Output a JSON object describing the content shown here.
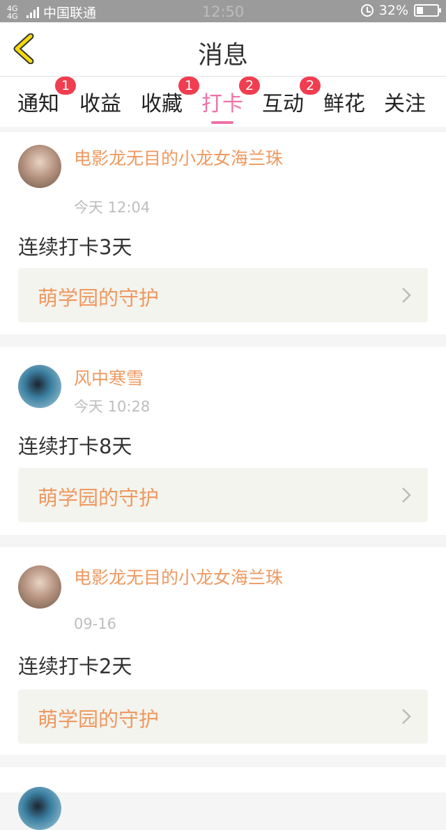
{
  "status_bar": {
    "network": "4G 4G",
    "carrier": "中国联通",
    "time": "12:50",
    "battery_percent": "32%",
    "battery_level": 0.32,
    "icons": [
      "signal-icon",
      "alarm-icon",
      "battery-icon"
    ]
  },
  "header": {
    "back_icon": "chevron-left-icon",
    "title": "消息"
  },
  "tabs": [
    {
      "label": "通知",
      "badge": "1",
      "active": false
    },
    {
      "label": "收益",
      "badge": "",
      "active": false
    },
    {
      "label": "收藏",
      "badge": "1",
      "active": false
    },
    {
      "label": "打卡",
      "badge": "2",
      "active": true
    },
    {
      "label": "互动",
      "badge": "2",
      "active": false
    },
    {
      "label": "鲜花",
      "badge": "",
      "active": false
    },
    {
      "label": "关注",
      "badge": "",
      "active": false
    }
  ],
  "colors": {
    "accent_pink": "#ee72a8",
    "name_orange": "#ee9960",
    "badge_red": "#f03e50"
  },
  "messages": [
    {
      "name": "电影龙无目的小龙女海兰珠",
      "time": "今天 12:04",
      "text": "连续打卡3天",
      "link": "萌学园的守护"
    },
    {
      "name": "风中寒雪",
      "time": "今天 10:28",
      "text": "连续打卡8天",
      "link": "萌学园的守护"
    },
    {
      "name": "电影龙无目的小龙女海兰珠",
      "time": "09-16",
      "text": "连续打卡2天",
      "link": "萌学园的守护"
    }
  ]
}
